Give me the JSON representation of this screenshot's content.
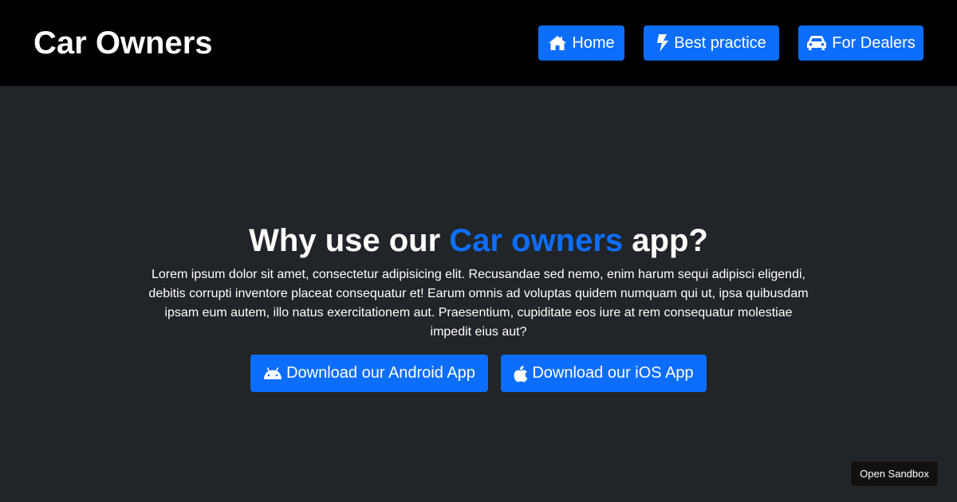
{
  "navbar": {
    "brand": "Car Owners",
    "items": [
      {
        "label": "Home",
        "icon": "home-icon"
      },
      {
        "label": "Best practice",
        "icon": "bolt-icon"
      },
      {
        "label": "For Dealers",
        "icon": "car-icon"
      }
    ]
  },
  "hero": {
    "title_prefix": "Why use our ",
    "title_accent": "Car owners",
    "title_suffix": " app?",
    "paragraph": "Lorem ipsum dolor sit amet, consectetur adipisicing elit. Recusandae sed nemo, enim harum sequi adipisci eligendi, debitis corrupti inventore placeat consequatur et! Earum omnis ad voluptas quidem numquam qui ut, ipsa quibusdam ipsam eum autem, illo natus exercitationem aut. Praesentium, cupiditate eos iure at rem consequatur molestiae impedit eius aut?",
    "buttons": [
      {
        "label": "Download our Android App",
        "icon": "android-icon"
      },
      {
        "label": "Download our iOS App",
        "icon": "apple-icon"
      }
    ]
  },
  "sandbox": {
    "label": "Open Sandbox"
  },
  "colors": {
    "accent": "#0d6efd",
    "navbar_bg": "#000000",
    "page_bg": "#212529"
  }
}
